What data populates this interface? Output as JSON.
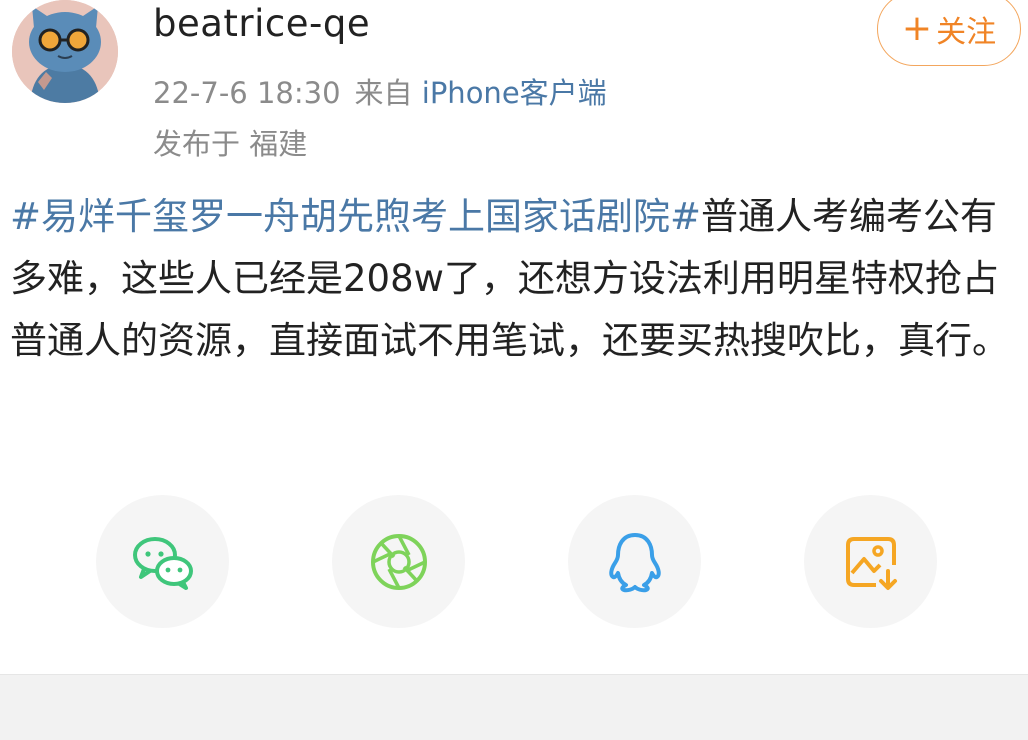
{
  "user": {
    "name": "beatrice-qe",
    "time": "22-7-6 18:30",
    "source_prefix": "来自",
    "source_client": "iPhone客户端",
    "location": "发布于  福建"
  },
  "follow": {
    "plus": "+",
    "label": "关注"
  },
  "post": {
    "hashtag": "#易烊千玺罗一舟胡先煦考上国家话剧院#",
    "body": "普通人考编考公有多难，这些人已经是208w了，还想方设法利用明星特权抢占普通人的资源，直接面试不用笔试，还要买热搜吹比，真行。"
  },
  "share": {
    "items": [
      {
        "icon": "wechat-icon",
        "color": "#3fc67b"
      },
      {
        "icon": "moments-icon",
        "color": "#7ed35a"
      },
      {
        "icon": "qq-icon",
        "color": "#3a9fe8"
      },
      {
        "icon": "save-image-icon",
        "color": "#f5a623"
      }
    ]
  },
  "colors": {
    "accent": "#f08426",
    "link": "#4a78a6",
    "muted": "#8b8b8b"
  }
}
